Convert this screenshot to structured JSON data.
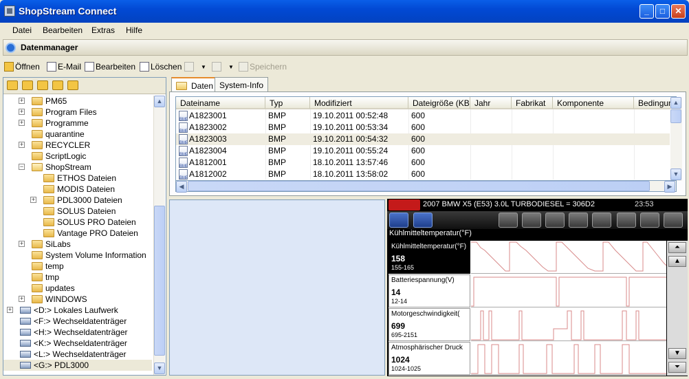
{
  "window": {
    "title": "ShopStream Connect"
  },
  "menu": [
    "Datei",
    "Bearbeiten",
    "Extras",
    "Hilfe"
  ],
  "section": {
    "title": "Datenmanager"
  },
  "toolbar": {
    "open": "Öffnen",
    "email": "E-Mail",
    "edit": "Bearbeiten",
    "delete": "Löschen",
    "save": "Speichern"
  },
  "tree": [
    {
      "label": "PM65",
      "depth": 1,
      "expander": true
    },
    {
      "label": "Program Files",
      "depth": 1,
      "expander": true
    },
    {
      "label": "Programme",
      "depth": 1,
      "expander": true
    },
    {
      "label": "quarantine",
      "depth": 1,
      "expander": false
    },
    {
      "label": "RECYCLER",
      "depth": 1,
      "expander": true
    },
    {
      "label": "ScriptLogic",
      "depth": 1,
      "expander": false
    },
    {
      "label": "ShopStream",
      "depth": 1,
      "expander": true,
      "open": true
    },
    {
      "label": "ETHOS Dateien",
      "depth": 2,
      "expander": false
    },
    {
      "label": "MODIS Dateien",
      "depth": 2,
      "expander": false
    },
    {
      "label": "PDL3000 Dateien",
      "depth": 2,
      "expander": true
    },
    {
      "label": "SOLUS Dateien",
      "depth": 2,
      "expander": false
    },
    {
      "label": "SOLUS PRO Dateien",
      "depth": 2,
      "expander": false
    },
    {
      "label": "Vantage PRO Dateien",
      "depth": 2,
      "expander": false
    },
    {
      "label": "SiLabs",
      "depth": 1,
      "expander": true
    },
    {
      "label": "System Volume Information",
      "depth": 1,
      "expander": false
    },
    {
      "label": "temp",
      "depth": 1,
      "expander": false
    },
    {
      "label": "tmp",
      "depth": 1,
      "expander": false
    },
    {
      "label": "updates",
      "depth": 1,
      "expander": false
    },
    {
      "label": "WINDOWS",
      "depth": 1,
      "expander": true
    },
    {
      "label": "<D:> Lokales Laufwerk",
      "depth": 0,
      "expander": true,
      "drive": true
    },
    {
      "label": "<F:> Wechseldatenträger",
      "depth": 0,
      "expander": false,
      "drive": true
    },
    {
      "label": "<H:> Wechseldatenträger",
      "depth": 0,
      "expander": false,
      "drive": true
    },
    {
      "label": "<K:> Wechseldatenträger",
      "depth": 0,
      "expander": false,
      "drive": true
    },
    {
      "label": "<L:> Wechseldatenträger",
      "depth": 0,
      "expander": false,
      "drive": true
    },
    {
      "label": "<G:> PDL3000",
      "depth": 0,
      "expander": false,
      "drive": true,
      "selected": true
    }
  ],
  "tabs": [
    "Daten",
    "System-Info"
  ],
  "table": {
    "columns": [
      "Dateiname",
      "Typ",
      "Modifiziert",
      "Dateigröße (KB)",
      "Jahr",
      "Fabrikat",
      "Komponente",
      "Bedingung"
    ],
    "rows": [
      [
        "A1823001",
        "BMP",
        "19.10.2011 00:52:48",
        "600"
      ],
      [
        "A1823002",
        "BMP",
        "19.10.2011 00:53:34",
        "600"
      ],
      [
        "A1823003",
        "BMP",
        "19.10.2011 00:54:32",
        "600"
      ],
      [
        "A1823004",
        "BMP",
        "19.10.2011 00:55:24",
        "600"
      ],
      [
        "A1812001",
        "BMP",
        "18.10.2011 13:57:46",
        "600"
      ],
      [
        "A1812002",
        "BMP",
        "18.10.2011 13:58:02",
        "600"
      ]
    ],
    "selected_row": 2
  },
  "scanner": {
    "vehicle": "2007 BMW X5 (E53) 3.0L TURBODIESEL = 306D2",
    "clock": "23:53",
    "sub_title": "Kühlmitteltemperatur(°F)",
    "signals": [
      {
        "name": "Kühlmitteltemperatur(°F)",
        "value": "158",
        "range": "155-165",
        "selected": true
      },
      {
        "name": "Batteriespannung(V)",
        "value": "14",
        "range": "12-14"
      },
      {
        "name": "Motorgeschwindigkeit(",
        "value": "699",
        "range": "695-2151"
      },
      {
        "name": "Atmosphärischer Druck",
        "value": "1024",
        "range": "1024-1025"
      }
    ]
  }
}
